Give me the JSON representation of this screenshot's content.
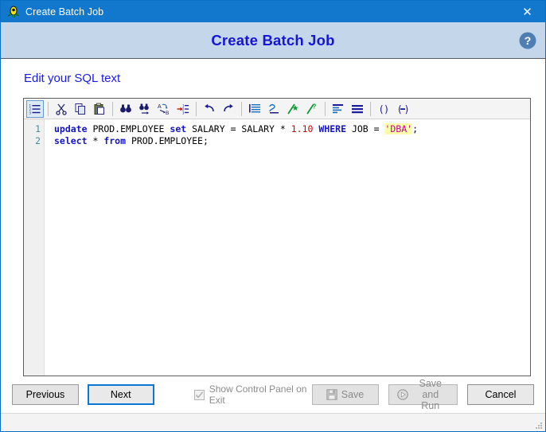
{
  "window": {
    "titlebar": {
      "icon": "app-rocket-icon",
      "title": "Create Batch Job",
      "close_label": "✕"
    },
    "banner": {
      "title": "Create Batch Job",
      "help_icon": "help-question-icon"
    }
  },
  "content": {
    "step_heading": "Edit your SQL text"
  },
  "editor": {
    "toolbar": {
      "buttons": [
        {
          "name": "line-numbers-icon",
          "label": "Line Numbers",
          "active": true
        },
        {
          "name": "cut-icon",
          "label": "Cut",
          "active": false
        },
        {
          "name": "copy-icon",
          "label": "Copy",
          "active": false
        },
        {
          "name": "paste-icon",
          "label": "Paste",
          "active": false
        },
        {
          "name": "find-icon",
          "label": "Find",
          "active": false
        },
        {
          "name": "find-next-icon",
          "label": "Find Next",
          "active": false
        },
        {
          "name": "replace-icon",
          "label": "Replace",
          "active": false
        },
        {
          "name": "goto-line-icon",
          "label": "Go To Line",
          "active": false
        },
        {
          "name": "undo-icon",
          "label": "Undo",
          "active": false
        },
        {
          "name": "redo-icon",
          "label": "Redo",
          "active": false
        },
        {
          "name": "indent-icon",
          "label": "Indent",
          "active": false
        },
        {
          "name": "outdent-icon",
          "label": "Outdent",
          "active": false
        },
        {
          "name": "comment-icon",
          "label": "Comment",
          "active": false
        },
        {
          "name": "uncomment-icon",
          "label": "Uncomment",
          "active": false
        },
        {
          "name": "align-left-icon",
          "label": "Align Left",
          "active": false
        },
        {
          "name": "align-block-icon",
          "label": "Align Block",
          "active": false
        },
        {
          "name": "match-parenthesis-icon",
          "label": "Match Parenthesis",
          "active": false
        },
        {
          "name": "collapse-icon",
          "label": "Collapse",
          "active": false
        }
      ]
    },
    "line_numbers": [
      "1",
      "2"
    ],
    "lines": [
      {
        "number": "1",
        "tokens": [
          {
            "t": "update",
            "k": "kw"
          },
          {
            "t": " PROD.EMPLOYEE ",
            "k": "plain"
          },
          {
            "t": "set",
            "k": "kw"
          },
          {
            "t": " SALARY = SALARY * ",
            "k": "plain"
          },
          {
            "t": "1.10",
            "k": "num"
          },
          {
            "t": " ",
            "k": "plain"
          },
          {
            "t": "WHERE",
            "k": "kw"
          },
          {
            "t": " JOB = ",
            "k": "plain"
          },
          {
            "t": "'DBA'",
            "k": "str"
          },
          {
            "t": ";",
            "k": "plain"
          }
        ]
      },
      {
        "number": "2",
        "tokens": [
          {
            "t": "select",
            "k": "kw"
          },
          {
            "t": " * ",
            "k": "plain"
          },
          {
            "t": "from",
            "k": "kw"
          },
          {
            "t": " PROD.EMPLOYEE;",
            "k": "plain"
          }
        ]
      }
    ]
  },
  "footer": {
    "previous_label": "Previous",
    "next_label": "Next",
    "checkbox": {
      "label": "Show Control Panel on Exit",
      "checked": true,
      "disabled": true
    },
    "save_label": "Save",
    "save_and_run_label": "Save and Run",
    "cancel_label": "Cancel"
  },
  "colors": {
    "titlebar": "#1278ce",
    "banner": "#c3d6ea",
    "banner_title": "#1515d8",
    "heading": "#1a1aee",
    "keyword": "#1414c8",
    "number": "#d40000",
    "string_text": "#c2009a",
    "string_highlight": "#ffffaa",
    "line_number": "#3f8f9e",
    "focus_border": "#0b77d4"
  }
}
